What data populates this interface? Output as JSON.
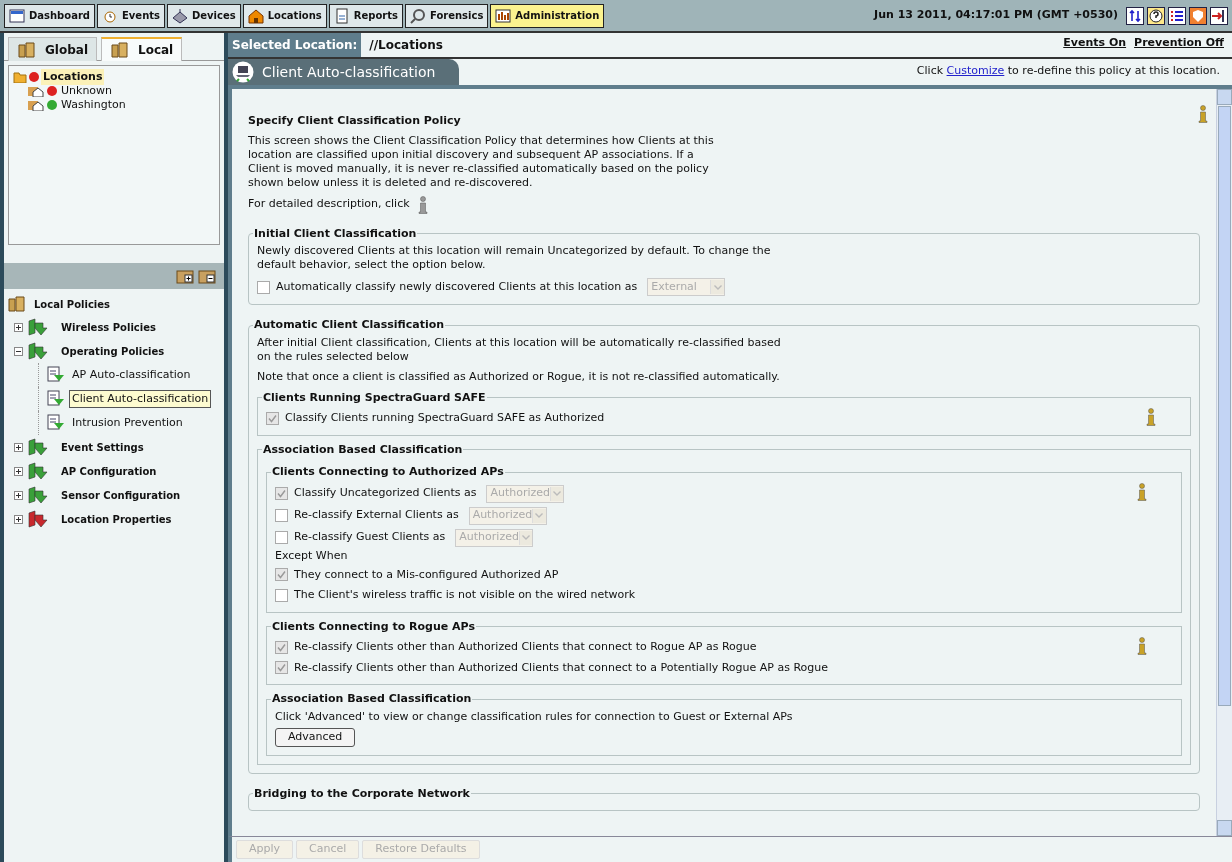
{
  "nav_tabs": [
    {
      "label": "Dashboard",
      "selected": false
    },
    {
      "label": "Events",
      "selected": false
    },
    {
      "label": "Devices",
      "selected": false
    },
    {
      "label": "Locations",
      "selected": false
    },
    {
      "label": "Reports",
      "selected": false
    },
    {
      "label": "Forensics",
      "selected": false
    },
    {
      "label": "Administration",
      "selected": true
    }
  ],
  "datetime": "Jun 13 2011, 04:17:01 PM (GMT +0530)",
  "left_tabs": [
    {
      "label": "Global",
      "selected": false
    },
    {
      "label": "Local",
      "selected": true
    }
  ],
  "location_tree": [
    {
      "label": "Locations",
      "color": "#dd2222",
      "selected": true,
      "children": [
        {
          "label": "Unknown",
          "color": "#dd2222",
          "selected": false
        },
        {
          "label": "Washington",
          "color": "#33aa33",
          "selected": false
        }
      ]
    }
  ],
  "policy_tree": {
    "label": "Local Policies",
    "children": [
      {
        "label": "Wireless Policies",
        "expanded": false,
        "color": "#3aa03a"
      },
      {
        "label": "Operating Policies",
        "expanded": true,
        "color": "#3aa03a",
        "children": [
          {
            "label": "AP Auto-classification",
            "selected": false
          },
          {
            "label": "Client Auto-classification",
            "selected": true
          },
          {
            "label": "Intrusion Prevention",
            "selected": false
          }
        ]
      },
      {
        "label": "Event Settings",
        "expanded": false,
        "color": "#3aa03a"
      },
      {
        "label": "AP Configuration",
        "expanded": false,
        "color": "#3aa03a"
      },
      {
        "label": "Sensor Configuration",
        "expanded": false,
        "color": "#3aa03a"
      },
      {
        "label": "Location Properties",
        "expanded": false,
        "color": "#c8282d"
      }
    ]
  },
  "selected_location": {
    "label": "Selected Location:",
    "value": "//Locations"
  },
  "status_links": [
    "Events On",
    "Prevention Off"
  ],
  "panel_title": "Client Auto-classification",
  "customize_note": {
    "before": "Click",
    "link": "Customize",
    "after": "to re-define this policy at this location."
  },
  "heading": "Specify Client Classification Policy",
  "description": "This screen shows the Client Classification Policy that determines how Clients at this location are classified upon initial discovery and subsequent AP associations. If a Client is moved manually, it is never re-classified automatically based on the policy shown below unless it is deleted and re-discovered.",
  "detail_note": "For detailed description, click",
  "groups": [
    {
      "title": "Initial Client Classification",
      "info": false,
      "items": [
        {
          "kind": "text",
          "text": "Newly discovered Clients at this location will remain Uncategorized by default. To change the default behavior, select the option below."
        },
        {
          "kind": "checkbox",
          "label": "Automatically classify newly discovered Clients at this location as",
          "checked": false,
          "select": "External"
        }
      ]
    },
    {
      "title": "Automatic Client Classification",
      "info": false,
      "items": [
        {
          "kind": "text",
          "text": "After initial Client classification, Clients at this location will be automatically re-classified based on the rules selected below"
        },
        {
          "kind": "text",
          "text": "Note that once a client is classified as Authorized or Rogue, it is not re-classified automatically."
        },
        {
          "kind": "group",
          "title": "Clients Running SpectraGuard SAFE",
          "info": true,
          "items": [
            {
              "kind": "checkbox",
              "label": "Classify Clients running SpectraGuard SAFE as Authorized",
              "checked": true
            }
          ]
        },
        {
          "kind": "group",
          "title": "Association Based Classification",
          "info": false,
          "items": [
            {
              "kind": "group",
              "title": "Clients Connecting to Authorized APs",
              "info": true,
              "items": [
                {
                  "kind": "checkbox",
                  "label": "Classify Uncategorized Clients as",
                  "checked": true,
                  "select": "Authorized"
                },
                {
                  "kind": "checkbox",
                  "label": "Re-classify External Clients as",
                  "checked": false,
                  "select": "Authorized"
                },
                {
                  "kind": "checkbox",
                  "label": "Re-classify Guest Clients as",
                  "checked": false,
                  "select": "Authorized"
                },
                {
                  "kind": "text",
                  "text": "Except When"
                },
                {
                  "kind": "checkbox",
                  "label": "They connect to a Mis-configured Authorized AP",
                  "checked": true
                },
                {
                  "kind": "checkbox",
                  "label": "The Client's wireless traffic is not visible on the wired network",
                  "checked": false
                }
              ]
            },
            {
              "kind": "group",
              "title": "Clients Connecting to Rogue APs",
              "info": true,
              "items": [
                {
                  "kind": "checkbox",
                  "label": "Re-classify Clients other than Authorized Clients that connect to Rogue AP as Rogue",
                  "checked": true
                },
                {
                  "kind": "checkbox",
                  "label": "Re-classify Clients other than Authorized Clients that connect to a Potentially Rogue AP as Rogue",
                  "checked": true
                }
              ]
            },
            {
              "kind": "group",
              "title": "Association Based Classification",
              "info": false,
              "items": [
                {
                  "kind": "text",
                  "text": "Click 'Advanced' to view or change classification rules for connection to Guest or External APs"
                },
                {
                  "kind": "button",
                  "label": "Advanced"
                }
              ]
            }
          ]
        }
      ]
    },
    {
      "title": "Bridging to the Corporate Network",
      "info": false
    }
  ],
  "footer_buttons": [
    {
      "label": "Apply",
      "disabled": true
    },
    {
      "label": "Cancel",
      "disabled": true
    },
    {
      "label": "Restore Defaults",
      "disabled": true
    }
  ]
}
